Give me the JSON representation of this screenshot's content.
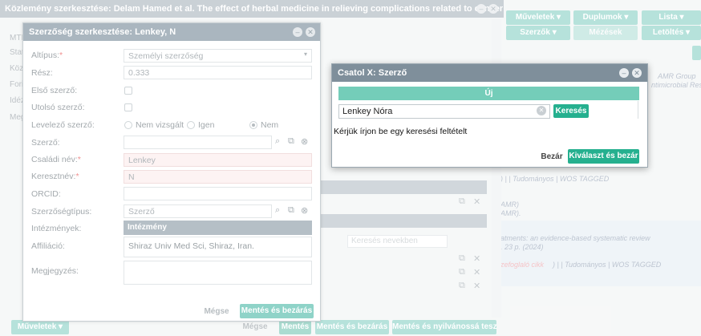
{
  "main": {
    "title": "Közlemény szerkesztése: Delam Hamed et al. The effect of herbal medicine in relieving complications related to cancer treat...",
    "side_labels": [
      "MTI",
      "Stat",
      "Köz",
      "Fori",
      "Idéz",
      "Meg"
    ],
    "toolbar": {
      "muveletek": "Műveletek",
      "duplumok": "Duplumok",
      "lista": "Lista",
      "szerzok": "Szerzők",
      "mezesek": "Mézések",
      "letoltes": "Letöltés"
    },
    "right_texts": {
      "amr_group": "AMR Group",
      "antimicrobial": "ntimicrobial Res",
      "tudomanyos1": ") | | Tudományos | WOS TAGGED",
      "amr1": "AMR)",
      "amr2": "AMR).",
      "treatments": "atments: an evidence-based systematic review",
      "pages": ". 23 p. (2024)",
      "osszefoglalo": "zefoglaló cikk",
      "tudomanyos2": ") | | Tudományos | WOS TAGGED"
    },
    "search_names_placeholder": "Keresés nevekben",
    "bottom": {
      "muveletek": "Műveletek",
      "megse": "Mégse",
      "mentes": "Mentés",
      "mentes_bezaras": "Mentés és bezárás",
      "mentes_nyilvanos": "Mentés és nyilvánossá tesz"
    }
  },
  "author_dialog": {
    "title": "Szerzőség szerkesztése: Lenkey, N",
    "fields": {
      "altipus_label": "Altípus:",
      "altipus_value": "Személyi szerzőség",
      "resz_label": "Rész:",
      "resz_value": "0.333",
      "elso_label": "Első szerző:",
      "utolso_label": "Utolsó szerző:",
      "levelezo_label": "Levelező szerző:",
      "levelezo_options": [
        "Nem vizsgált",
        "Igen",
        "Nem"
      ],
      "szerzo_label": "Szerző:",
      "csaladi_label": "Családi név:",
      "csaladi_value": "Lenkey",
      "kereszt_label": "Keresztnév:",
      "kereszt_value": "N",
      "orcid_label": "ORCID:",
      "szerzosegtipus_label": "Szerzőségtípus:",
      "szerzosegtipus_value": "Szerző",
      "intezmenyek_label": "Intézmények:",
      "intezmeny_header": "Intézmény",
      "affiliacio_label": "Affiliáció:",
      "affiliacio_value": "Shiraz Univ Med Sci, Shiraz, Iran.",
      "megjegyzes_label": "Megjegyzés:"
    },
    "buttons": {
      "megse": "Mégse",
      "mentes_bezaras": "Mentés és bezárás"
    }
  },
  "search_dialog": {
    "title": "Csatol X: Szerző",
    "new_label": "Új",
    "search_value": "Lenkey Nóra",
    "search_button": "Keresés",
    "hint": "Kérjük írjon be egy keresési feltételt",
    "close_button": "Bezár",
    "select_close_button": "Kiválaszt és bezár"
  },
  "colors": {
    "teal_light": "#8fd3c8",
    "teal_dark": "#25b08f",
    "titlebar": "#7f8f9b"
  }
}
